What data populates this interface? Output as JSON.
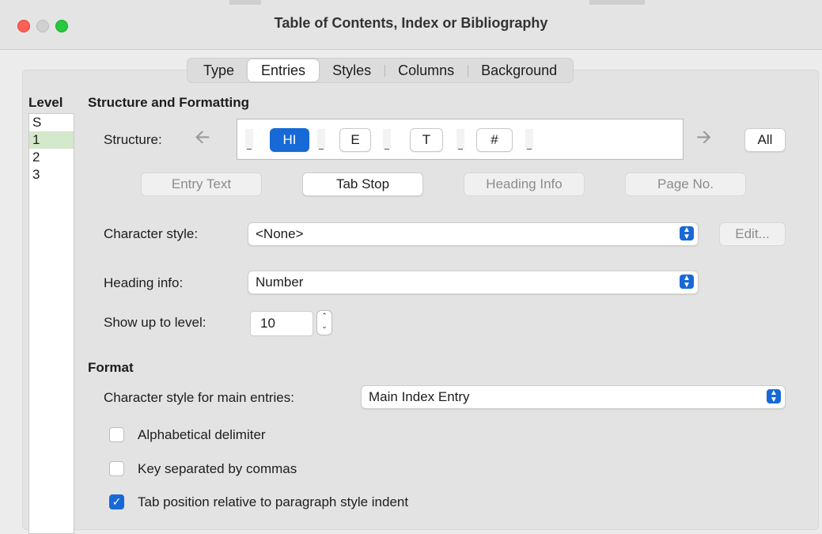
{
  "window": {
    "title": "Table of Contents, Index or Bibliography"
  },
  "tabs": [
    {
      "label": "Type"
    },
    {
      "label": "Entries",
      "active": true
    },
    {
      "label": "Styles"
    },
    {
      "label": "Columns"
    },
    {
      "label": "Background"
    }
  ],
  "level": {
    "heading": "Level",
    "items": [
      "S",
      "1",
      "2",
      "3"
    ],
    "selected": "1"
  },
  "structure_formatting": {
    "heading": "Structure and Formatting",
    "structure_label": "Structure:",
    "tokens": [
      "HI",
      "E",
      "T",
      "#"
    ],
    "active_token": "HI",
    "all_label": "All",
    "buttons": {
      "entry_text": "Entry Text",
      "tab_stop": "Tab Stop",
      "heading_info": "Heading Info",
      "page_no": "Page No."
    },
    "character_style_label": "Character style:",
    "character_style_value": "<None>",
    "edit_label": "Edit...",
    "heading_info_label": "Heading info:",
    "heading_info_value": "Number",
    "show_up_to_level_label": "Show up to level:",
    "show_up_to_level_value": "10"
  },
  "format": {
    "heading": "Format",
    "main_entries_label": "Character style for main entries:",
    "main_entries_value": "Main Index Entry",
    "checkboxes": [
      {
        "label": "Alphabetical delimiter",
        "checked": false
      },
      {
        "label": "Key separated by commas",
        "checked": false
      },
      {
        "label": "Tab position relative to paragraph style indent",
        "checked": true
      }
    ]
  },
  "colors": {
    "accent": "#1769d6",
    "selected_row": "#d4e8cc"
  }
}
